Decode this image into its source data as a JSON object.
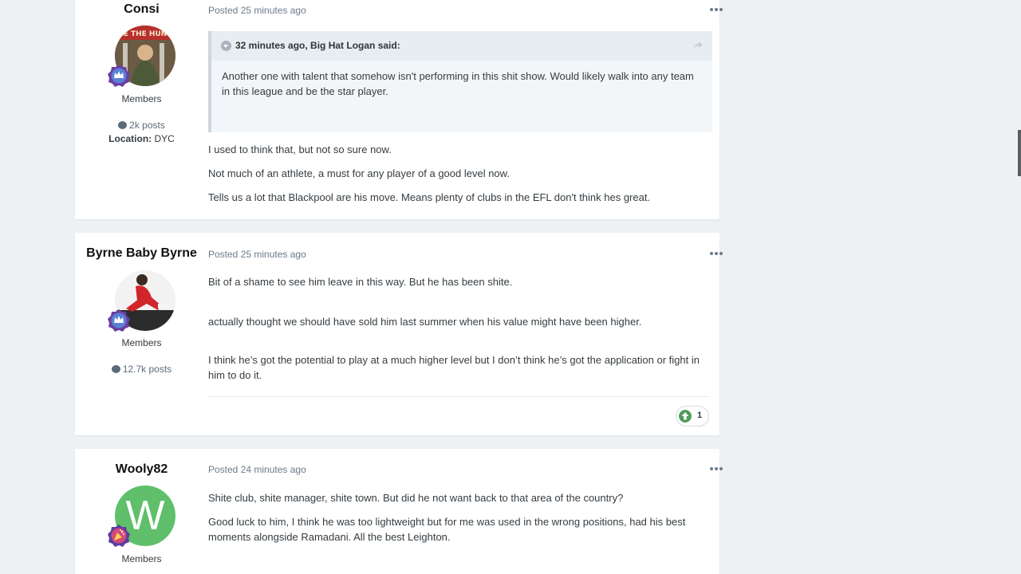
{
  "posts": [
    {
      "author": "Consi",
      "posted": "Posted 25 minutes ago",
      "group": "Members",
      "post_count": "2k posts",
      "location_label": "Location:",
      "location_value": "DYC",
      "quote": {
        "cite": "32 minutes ago, Big Hat Logan said:",
        "text": "Another one with talent that somehow isn't performing in this shit show. Would likely walk into any team in this league and be the star player."
      },
      "paragraphs": [
        "I used to think that, but not so sure now.",
        "Not much of an athlete, a must for any player of a good level now.",
        "Tells us a lot that Blackpool are his move. Means plenty of clubs in the EFL don't think hes great."
      ]
    },
    {
      "author": "Byrne Baby Byrne",
      "posted": "Posted 25 minutes ago",
      "group": "Members",
      "post_count": "12.7k posts",
      "paragraphs": [
        "Bit of a shame to see him leave in this way. But he has been shite.",
        "actually thought we should have sold him last summer when his value might have been higher.",
        "I think he’s got the potential to play at a much higher level but I don’t think he’s got the application or fight in him to do it."
      ],
      "reaction_count": "1"
    },
    {
      "author": "Wooly82",
      "posted": "Posted 24 minutes ago",
      "group": "Members",
      "avatar_letter": "W",
      "paragraphs": [
        "Shite club, shite manager, shite town. But did he not want back to that area of the country?",
        "Good luck to him, I think he was too lightweight but for me was used in the wrong positions, had his best moments alongside Ramadani. All the best Leighton."
      ]
    }
  ],
  "colors": {
    "page_bg": "#eef1f4",
    "card_bg": "#ffffff",
    "meta_text": "#6a7b8c",
    "upvote_green": "#4d9a57",
    "wooly_avatar": "#5fbf6a"
  },
  "icons": {
    "menu": "ellipsis-icon",
    "comment": "comment-icon",
    "rank": "crown-badge-icon",
    "quote_toggle": "chevron-down-icon",
    "share": "share-icon",
    "reaction": "upvote-icon"
  }
}
